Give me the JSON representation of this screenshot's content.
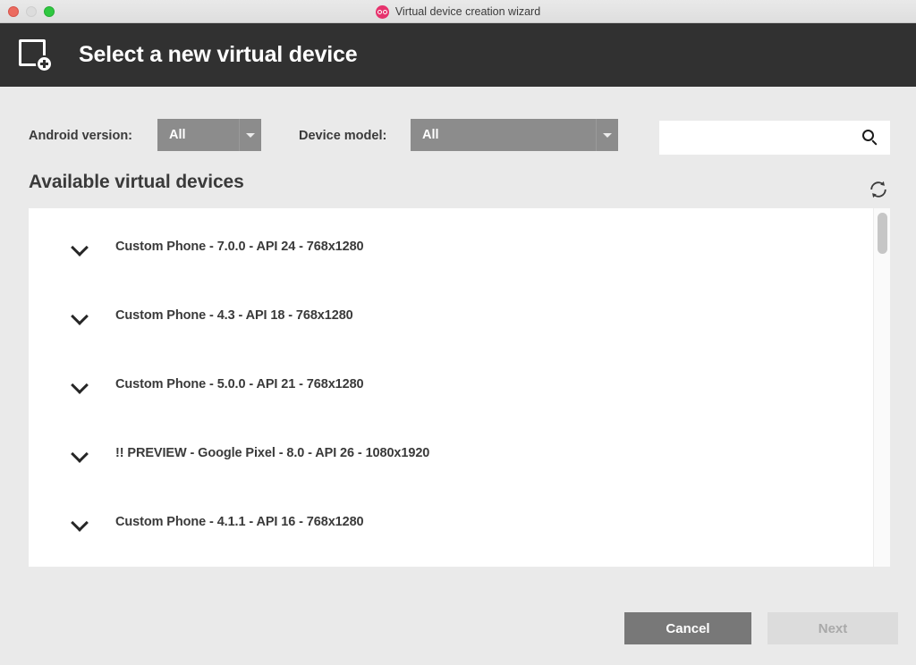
{
  "window": {
    "title": "Virtual device creation wizard",
    "logo_icon": "genymotion-goggles-icon",
    "controls": {
      "close": "close-button",
      "minimize": "minimize-button",
      "zoom": "zoom-button"
    }
  },
  "header": {
    "icon": "new-device-icon",
    "title": "Select a new virtual device"
  },
  "filters": {
    "android_version": {
      "label": "Android version:",
      "value": "All",
      "arrow_icon": "chevron-down-icon"
    },
    "device_model": {
      "label": "Device model:",
      "value": "All",
      "arrow_icon": "chevron-down-icon"
    },
    "search": {
      "value": "",
      "placeholder": "",
      "icon": "search-icon"
    }
  },
  "list_section": {
    "heading": "Available virtual devices",
    "refresh_icon": "refresh-icon",
    "items": [
      {
        "expand_icon": "chevron-down-icon",
        "label": "Custom Phone - 7.0.0 - API 24 - 768x1280"
      },
      {
        "expand_icon": "chevron-down-icon",
        "label": "Custom Phone - 4.3 - API 18 - 768x1280"
      },
      {
        "expand_icon": "chevron-down-icon",
        "label": "Custom Phone - 5.0.0 - API 21 - 768x1280"
      },
      {
        "expand_icon": "chevron-down-icon",
        "label": "!! PREVIEW - Google Pixel - 8.0 - API 26 - 1080x1920"
      },
      {
        "expand_icon": "chevron-down-icon",
        "label": "Custom Phone - 4.1.1 - API 16 - 768x1280"
      }
    ]
  },
  "footer": {
    "cancel_label": "Cancel",
    "next_label": "Next",
    "next_disabled": true
  },
  "colors": {
    "header_bg": "#313131",
    "page_bg": "#eaeaea",
    "accent_logo": "#e6336d",
    "dropdown_bg": "#8c8c8c",
    "cancel_bg": "#787878",
    "next_bg": "#dcdcdc"
  }
}
